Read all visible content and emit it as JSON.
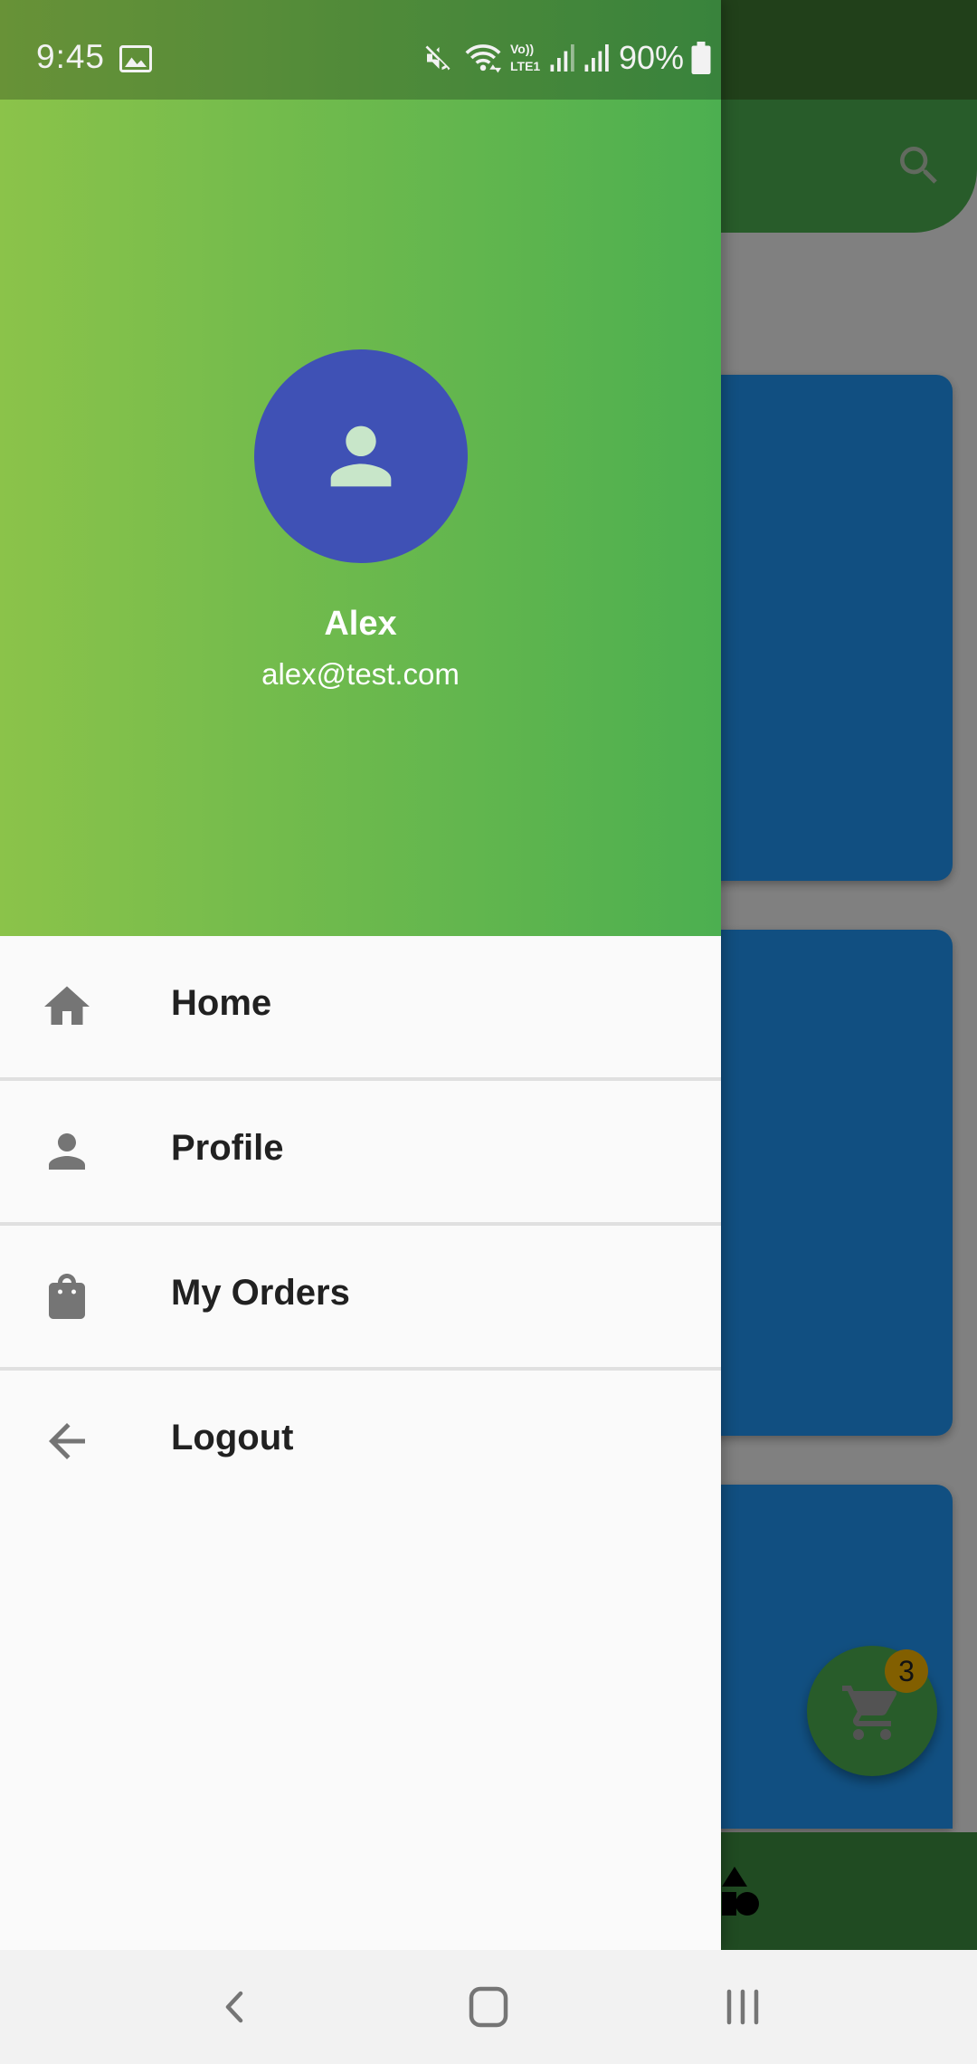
{
  "status_bar": {
    "time": "9:45",
    "battery_percent": "90%",
    "icons": [
      "image-icon",
      "mute-icon",
      "wifi-icon",
      "volte-icon",
      "signal-icon",
      "signal-icon",
      "battery-icon"
    ]
  },
  "background_app": {
    "cart_badge_count": "3",
    "colors": {
      "appbar": "#4caf50",
      "card": "#2196f3",
      "fab": "#4caf50",
      "badge": "#f5b400"
    }
  },
  "drawer": {
    "header": {
      "user_name": "Alex",
      "user_email": "alex@test.com",
      "avatar_icon": "person-icon",
      "gradient": [
        "#8bc34a",
        "#4caf50"
      ],
      "avatar_color": "#3f51b5"
    },
    "items": [
      {
        "label": "Home",
        "icon": "home-icon"
      },
      {
        "label": "Profile",
        "icon": "person-icon"
      },
      {
        "label": "My Orders",
        "icon": "shopping-bag-icon"
      },
      {
        "label": "Logout",
        "icon": "arrow-back-icon"
      }
    ]
  },
  "system_nav": {
    "buttons": [
      "back-icon",
      "home-icon",
      "recents-icon"
    ]
  }
}
